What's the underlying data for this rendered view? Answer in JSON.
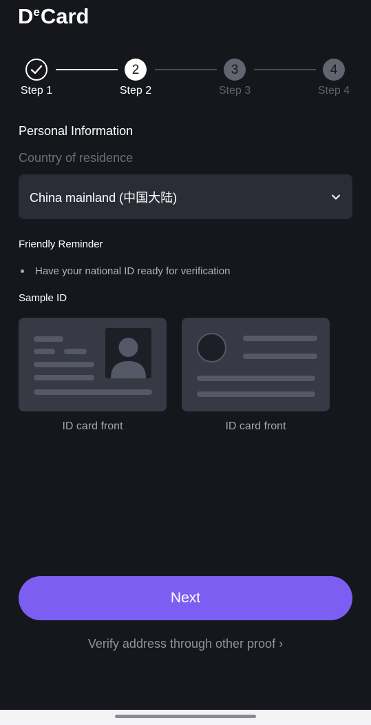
{
  "app": {
    "logo_d": "D",
    "logo_e": "e",
    "logo_card": "Card"
  },
  "stepper": {
    "steps": [
      {
        "label": "Step 1",
        "number": "1",
        "state": "completed"
      },
      {
        "label": "Step 2",
        "number": "2",
        "state": "current"
      },
      {
        "label": "Step 3",
        "number": "3",
        "state": "upcoming"
      },
      {
        "label": "Step 4",
        "number": "4",
        "state": "upcoming"
      }
    ]
  },
  "form": {
    "section_title": "Personal Information",
    "country_label": "Country of residence",
    "country_value": "China mainland (中国大陆)"
  },
  "reminder": {
    "title": "Friendly Reminder",
    "items": [
      "Have your national ID ready for verification"
    ]
  },
  "samples": {
    "title": "Sample ID",
    "cards": [
      {
        "caption": "ID card front"
      },
      {
        "caption": "ID card front"
      }
    ]
  },
  "actions": {
    "next_label": "Next",
    "alt_link": "Verify address through other proof ›"
  },
  "colors": {
    "background": "#16171c",
    "accent": "#7c5ef2",
    "field_bg": "#2a2c36",
    "card_bg": "#373944"
  }
}
